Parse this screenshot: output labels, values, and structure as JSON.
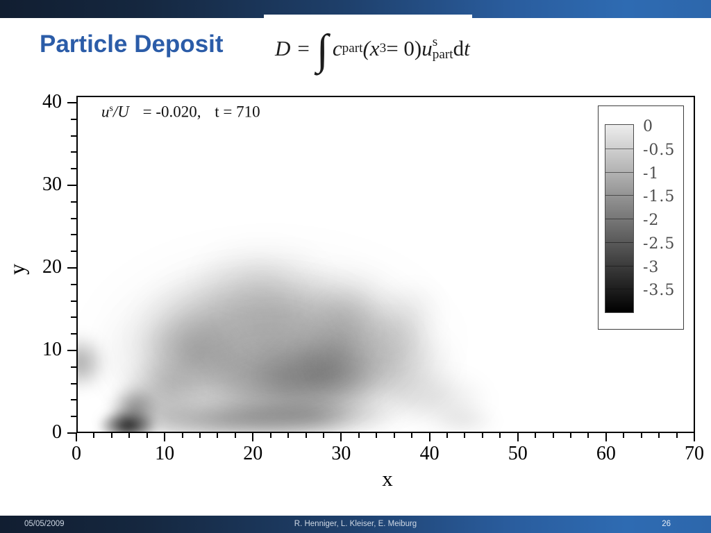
{
  "header": {
    "title": "Particle Deposit"
  },
  "formula": {
    "D": "D",
    "eq": "=",
    "integral": "∫",
    "c": "c",
    "c_sub": "part",
    "open_x": "(x",
    "x_sub": "3",
    "close": "= 0)",
    "u": "u",
    "u_sup": "s",
    "u_sub": "part",
    "d": "d",
    "t": "t"
  },
  "footer": {
    "date": "05/05/2009",
    "authors": "R. Henniger, L. Kleiser, E. Meiburg",
    "page_number": "26"
  },
  "chart_data": {
    "type": "heatmap",
    "description": "Grayscale particle deposit density field on bottom wall; dark = high deposit. Deposit occupies roughly 0<x<46, 0<y<22 with a near-black peak around x=6, y=1 and a broad dark core around x=18-32, y=3-10.",
    "xlabel": "x",
    "ylabel": "y",
    "xlim": [
      0,
      70
    ],
    "ylim": [
      0,
      40
    ],
    "x_ticks": [
      0,
      10,
      20,
      30,
      40,
      50,
      60,
      70
    ],
    "y_ticks": [
      0,
      10,
      20,
      30,
      40
    ],
    "minor_tick_step": 2,
    "grid": false,
    "annotation": {
      "u": "u",
      "u_sup": "s",
      "slash_U": "/U",
      "value": "= -0.020,",
      "time": "t = 710"
    },
    "colorbar": {
      "labels": [
        "0",
        "-0.5",
        "-1",
        "-1.5",
        "-2",
        "-2.5",
        "-3",
        "-3.5"
      ],
      "levels": [
        0,
        -0.5,
        -1,
        -1.5,
        -2,
        -2.5,
        -3,
        -3.5
      ],
      "orientation": "white = 0 at top to black = -3.5 at bottom",
      "top_color": "#ededed",
      "bottom_color": "#000000"
    },
    "density_blobs": [
      {
        "u": 22,
        "v": 11,
        "rx": 22,
        "ry": 13,
        "a": 0.08,
        "blur": 26,
        "rot": 0
      },
      {
        "u": 21,
        "v": 9,
        "rx": 18,
        "ry": 10,
        "a": 0.26,
        "blur": 22,
        "rot": 0
      },
      {
        "u": 23,
        "v": 6,
        "rx": 11,
        "ry": 5.5,
        "a": 0.3,
        "blur": 16,
        "rot": 0
      },
      {
        "u": 28,
        "v": 7,
        "rx": 7,
        "ry": 5,
        "a": 0.28,
        "blur": 14,
        "rot": 0
      },
      {
        "u": 17,
        "v": 1.5,
        "rx": 15,
        "ry": 2.6,
        "a": 0.36,
        "blur": 10,
        "rot": 0
      },
      {
        "u": 27,
        "v": 2,
        "rx": 10,
        "ry": 2.4,
        "a": 0.28,
        "blur": 10,
        "rot": 0
      },
      {
        "u": 5.8,
        "v": 0.9,
        "rx": 3.4,
        "ry": 1.9,
        "a": 0.92,
        "blur": 6,
        "rot": 0
      },
      {
        "u": 6.5,
        "v": 3,
        "rx": 3,
        "ry": 2.8,
        "a": 0.45,
        "blur": 8,
        "rot": -20
      },
      {
        "u": 0.4,
        "v": 8.5,
        "rx": 3,
        "ry": 3.4,
        "a": 0.38,
        "blur": 10,
        "rot": 0
      },
      {
        "u": 10,
        "v": 5,
        "rx": 5,
        "ry": 4.2,
        "a": 0.24,
        "blur": 12,
        "rot": 0
      },
      {
        "u": 13,
        "v": 9.5,
        "rx": 6,
        "ry": 5,
        "a": 0.2,
        "blur": 12,
        "rot": 0
      },
      {
        "u": 16,
        "v": 14,
        "rx": 10,
        "ry": 6.5,
        "a": 0.18,
        "blur": 16,
        "rot": -15
      },
      {
        "u": 25,
        "v": 14,
        "rx": 9,
        "ry": 6,
        "a": 0.2,
        "blur": 16,
        "rot": 10
      },
      {
        "u": 30,
        "v": 11,
        "rx": 5,
        "ry": 7,
        "a": 0.16,
        "blur": 12,
        "rot": 30
      },
      {
        "u": 35,
        "v": 8,
        "rx": 8,
        "ry": 6,
        "a": 0.22,
        "blur": 16,
        "rot": 0
      },
      {
        "u": 37,
        "v": 13,
        "rx": 4,
        "ry": 6,
        "a": 0.11,
        "blur": 12,
        "rot": 35
      },
      {
        "u": 41,
        "v": 4,
        "rx": 6,
        "ry": 3.5,
        "a": 0.13,
        "blur": 14,
        "rot": 0
      },
      {
        "u": 44,
        "v": 1.5,
        "rx": 4,
        "ry": 1.8,
        "a": 0.1,
        "blur": 10,
        "rot": 0
      },
      {
        "u": 21,
        "v": 19,
        "rx": 8,
        "ry": 4,
        "a": 0.09,
        "blur": 16,
        "rot": 0
      },
      {
        "u": 32,
        "v": 15,
        "rx": 7,
        "ry": 5,
        "a": 0.13,
        "blur": 14,
        "rot": 25
      }
    ]
  },
  "colors": {
    "bar_dark": "#111e31",
    "bar_light": "#2e6bb2",
    "title_blue": "#2b5ca8"
  }
}
